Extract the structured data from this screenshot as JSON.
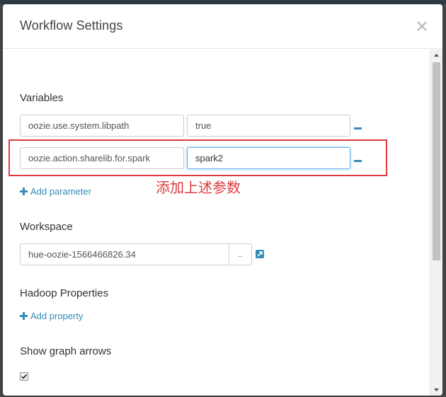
{
  "dialog": {
    "title": "Workflow Settings"
  },
  "variables": {
    "section_title": "Variables",
    "rows": [
      {
        "name": "oozie.use.system.libpath",
        "value": "true"
      },
      {
        "name": "oozie.action.sharelib.for.spark",
        "value": "spark2"
      }
    ],
    "add_label": "Add parameter"
  },
  "annotation": {
    "text": "添加上述参数",
    "color": "#e0393e"
  },
  "workspace": {
    "section_title": "Workspace",
    "value": "hue-oozie-1566466826.34",
    "browse_label": ".."
  },
  "hadoop_properties": {
    "section_title": "Hadoop Properties",
    "add_label": "Add property"
  },
  "graph_arrows": {
    "section_title": "Show graph arrows",
    "checked": true
  },
  "icons": {
    "close": "close-icon",
    "minus": "minus-icon",
    "plus": "plus-icon",
    "open": "external-open-icon",
    "check": "check-icon"
  },
  "colors": {
    "accent": "#338bb8",
    "highlight": "#e0393e",
    "focus_border": "#66afe9"
  }
}
